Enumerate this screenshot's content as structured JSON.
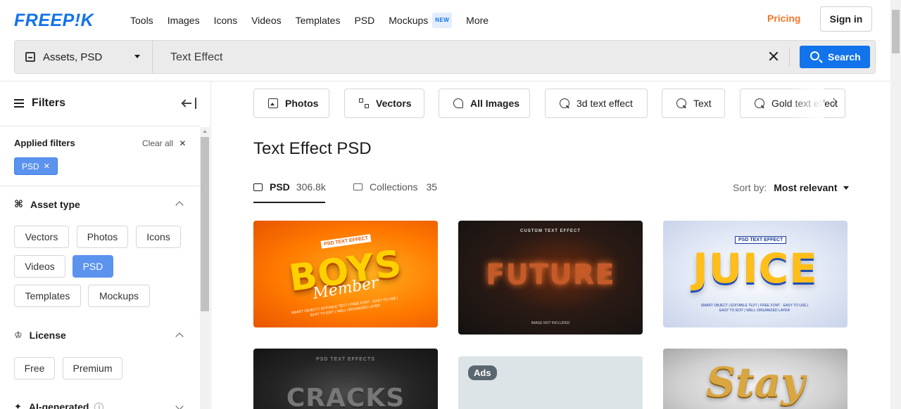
{
  "brand": {
    "logo_text": "FREEP!K",
    "accent": "#1273eb",
    "pricing_color": "#f2772a"
  },
  "nav": {
    "items": [
      "Tools",
      "Images",
      "Icons",
      "Videos",
      "Templates",
      "PSD",
      "Mockups",
      "More"
    ],
    "new_badge": "NEW"
  },
  "header": {
    "pricing": "Pricing",
    "signin": "Sign in"
  },
  "search": {
    "scope": "Assets, PSD",
    "value": "Text Effect",
    "button": "Search"
  },
  "sidebar": {
    "title": "Filters",
    "applied_label": "Applied filters",
    "clear_all": "Clear all",
    "applied_chip": "PSD",
    "asset_type": {
      "title": "Asset type",
      "options": [
        "Vectors",
        "Photos",
        "Icons",
        "Videos",
        "PSD",
        "Templates",
        "Mockups"
      ],
      "selected": "PSD"
    },
    "license": {
      "title": "License",
      "options": [
        "Free",
        "Premium"
      ]
    },
    "ai_generated": {
      "title": "AI-generated"
    }
  },
  "chips": [
    {
      "label": "Photos",
      "icon": "photo-icon"
    },
    {
      "label": "Vectors",
      "icon": "vector-icon"
    },
    {
      "label": "All Images",
      "icon": "all-images-icon"
    },
    {
      "label": "3d text effect",
      "icon": "search-icon"
    },
    {
      "label": "Text",
      "icon": "search-icon"
    },
    {
      "label": "Gold text effect",
      "icon": "search-icon"
    }
  ],
  "main": {
    "title": "Text Effect PSD",
    "tabs": [
      {
        "label": "PSD",
        "count": "306.8k"
      },
      {
        "label": "Collections",
        "count": "35"
      }
    ],
    "sort_label": "Sort by:",
    "sort_value": "Most relevant"
  },
  "cards": [
    {
      "headline": "BOYS",
      "sub": "Member",
      "tag": "PSD TEXT EFFECT",
      "caption": "SMART OBJECT | EDITABLE TEXT | FREE FONT · EASY TO USE | EASY TO EDIT | WELL ORGANIZED LAYER"
    },
    {
      "headline": "FUTURE",
      "tag": "CUSTOM TEXT EFFECT",
      "caption": "IMAGE NOT INCLUDED"
    },
    {
      "headline": "JUICE",
      "tag": "PSD TEXT EFFECT",
      "caption": "SMART OBJECT | EDITABLE TEXT | FREE FONT · EASY TO USE | EASY TO EDIT | WELL ORGANIZED LAYER"
    },
    {
      "headline": "CRACKS",
      "tag": "PSD TEXT EFFECTS"
    },
    {
      "ads": "Ads"
    },
    {
      "headline": "Stay"
    }
  ]
}
